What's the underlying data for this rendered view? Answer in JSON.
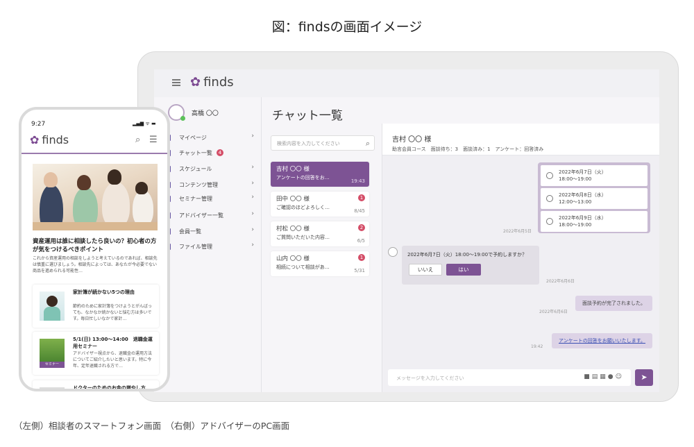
{
  "figure": {
    "title": "図：findsの画面イメージ",
    "caption": "（左側）相談者のスマートフォン画面　（右側）アドバイザーのPC画面"
  },
  "brand": {
    "name": "finds",
    "accent": "#7d5394"
  },
  "pc": {
    "user": {
      "name": "高橋 〇〇"
    },
    "sidebar": {
      "items": [
        {
          "label": "マイページ",
          "icon": "user-icon",
          "chevron": "›"
        },
        {
          "label": "チャット一覧",
          "icon": "chat-icon",
          "badge": "4"
        },
        {
          "label": "スケジュール",
          "icon": "calendar-icon",
          "chevron": "›"
        },
        {
          "label": "コンテンツ管理",
          "icon": "content-icon",
          "chevron": "›"
        },
        {
          "label": "セミナー管理",
          "icon": "seminar-icon",
          "chevron": "›"
        },
        {
          "label": "アドバイザー一覧",
          "icon": "advisor-icon",
          "chevron": "›"
        },
        {
          "label": "会員一覧",
          "icon": "members-icon",
          "chevron": "›"
        },
        {
          "label": "ファイル管理",
          "icon": "folder-icon",
          "chevron": "›"
        }
      ]
    },
    "page_title": "チャット一覧",
    "search": {
      "placeholder": "検索内容を入力してください"
    },
    "chats": [
      {
        "name": "吉村 〇〇 様",
        "preview": "アンケートの回答をお…",
        "date": "19:43",
        "selected": true
      },
      {
        "name": "田中 〇〇 様",
        "preview": "ご確認のほどよろしく…",
        "date": "8/45",
        "count": "1"
      },
      {
        "name": "村松 〇〇 様",
        "preview": "ご質問いただいた内容…",
        "date": "6/5",
        "count": "2"
      },
      {
        "name": "山内 〇〇 様",
        "preview": "相続について相談があ…",
        "date": "5/31",
        "count": "1"
      }
    ],
    "chat": {
      "name": "吉村 〇〇 様",
      "detail": "助言会員コース　面談待ち：3　面談済み：1　アンケート：回答済み",
      "options": [
        {
          "date": "2022年6月7日（火）",
          "time": "18:00〜19:00"
        },
        {
          "date": "2022年6月8日（水）",
          "time": "12:00〜13:00"
        },
        {
          "date": "2022年6月9日（水）",
          "time": "18:00〜19:00"
        }
      ],
      "ts1": "2022年6月5日",
      "question": "2022年6月7日（火）18:00〜19:00で予約しますか？",
      "no_label": "いいえ",
      "yes_label": "はい",
      "ts2": "2022年6月6日",
      "confirm": "面談予約が完了されました。",
      "ts3": "2022年6月6日",
      "link_msg": "アンケートの回答をお願いいたします。",
      "ts4": "19:42",
      "input_placeholder": "メッセージを入力してください",
      "send_icon": "➤"
    }
  },
  "phone": {
    "time": "9:27",
    "signal": "▂▄▆ ᯤ ▬",
    "article": {
      "title": "資産運用は誰に相談したら良いの？初心者の方が気をつけるべきポイント",
      "body": "これから資産運用の相談をしようと考えているのであれば、相談先は慎重に選びましょう。相談先によっては、あなたが今必要でない商品を進められる可能性…"
    },
    "cards": [
      {
        "title": "家計簿が続かない5つの理由",
        "body": "節約のために家計簿をつけようとがんばっても、なかなか続かないと悩む方は多いです。毎日忙しいなかで家計…"
      },
      {
        "title": "5/1(日) 13:00〜14:00　退職金運用セミナー",
        "body": "アドバイザー視点から、退職金の運用方法についてご紹介したいと思います。特に今年、定年退職される方で…",
        "thumb_label": "セミナー"
      },
      {
        "title": "ドクターのためのお金の増やし方",
        "body": ""
      }
    ]
  }
}
